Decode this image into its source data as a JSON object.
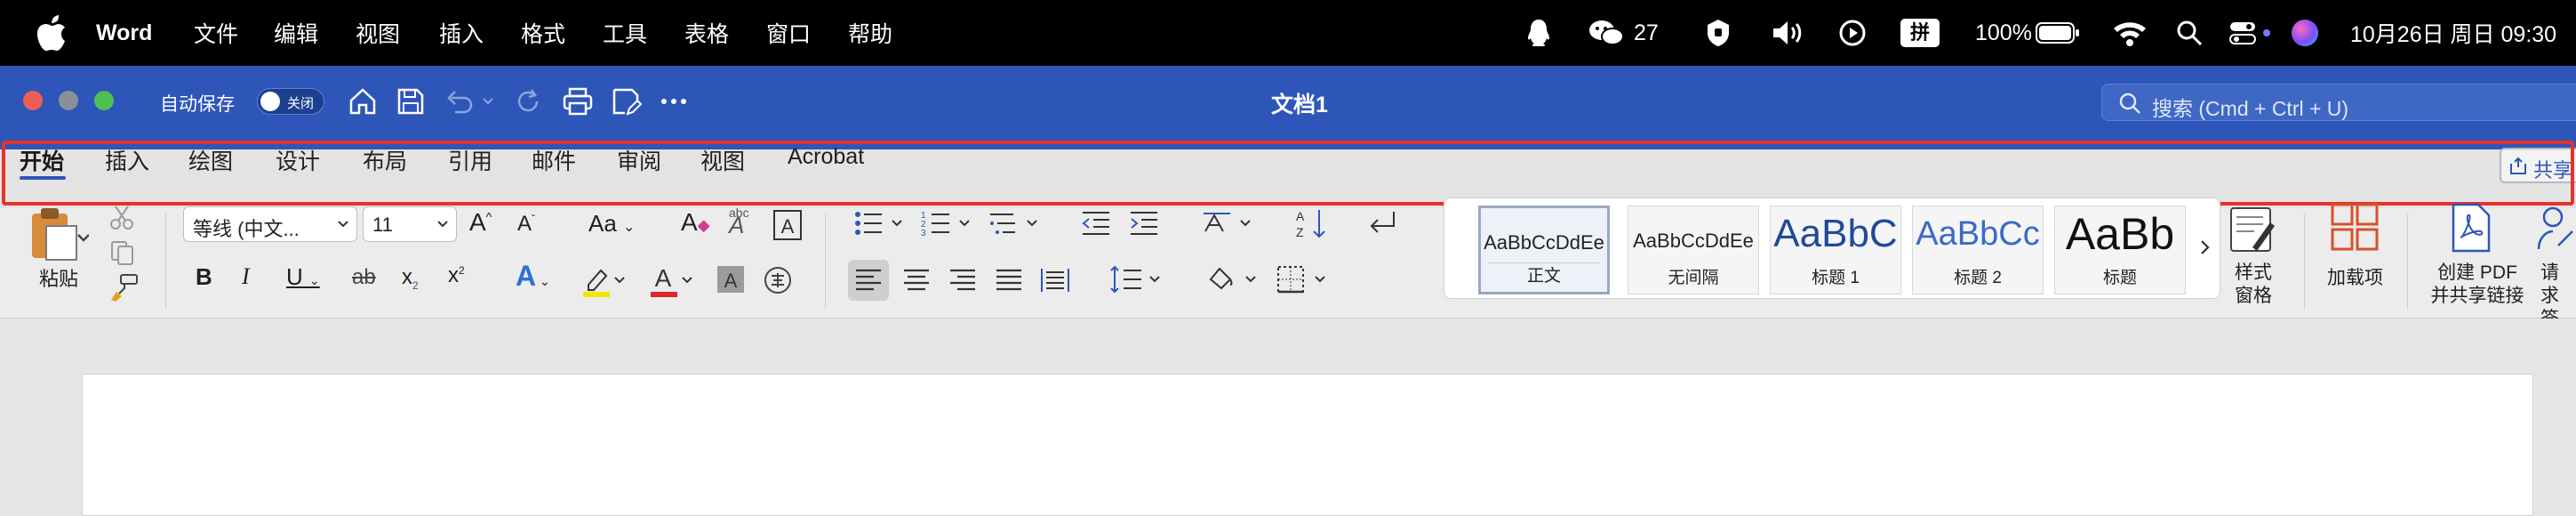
{
  "menubar": {
    "app_name": "Word",
    "items": [
      "文件",
      "编辑",
      "视图",
      "插入",
      "格式",
      "工具",
      "表格",
      "窗口",
      "帮助"
    ],
    "status": {
      "wechat_count": "27",
      "battery": "100%",
      "datetime": "10月26日 周日 09:30",
      "input_method": "拼"
    }
  },
  "titlebar": {
    "autosave_label": "自动保存",
    "autosave_state": "关闭",
    "document_title": "文档1",
    "search_placeholder": "搜索 (Cmd + Ctrl + U)"
  },
  "tabs": [
    "开始",
    "插入",
    "绘图",
    "设计",
    "布局",
    "引用",
    "邮件",
    "审阅",
    "视图",
    "Acrobat"
  ],
  "share_label": "共享",
  "ribbon": {
    "paste_label": "粘贴",
    "font_name": "等线 (中文...",
    "font_size": "11",
    "change_case": "Aa",
    "styles": [
      {
        "sample": "AaBbCcDdEe",
        "name": "正文"
      },
      {
        "sample": "AaBbCcDdEe",
        "name": "无间隔"
      },
      {
        "sample": "AaBbC",
        "name": "标题 1"
      },
      {
        "sample": "AaBbCc",
        "name": "标题 2"
      },
      {
        "sample": "AaBb",
        "name": "标题"
      }
    ],
    "styles_pane_label": [
      "样式",
      "窗格"
    ],
    "addins_label": "加载项",
    "create_pdf_label": [
      "创建 PDF",
      "并共享链接"
    ],
    "request_sign_label": [
      "请求",
      "签名"
    ]
  },
  "colors": {
    "accent": "#2d56b8",
    "highlight_frame": "#e6312d",
    "menubar": "#000000"
  }
}
